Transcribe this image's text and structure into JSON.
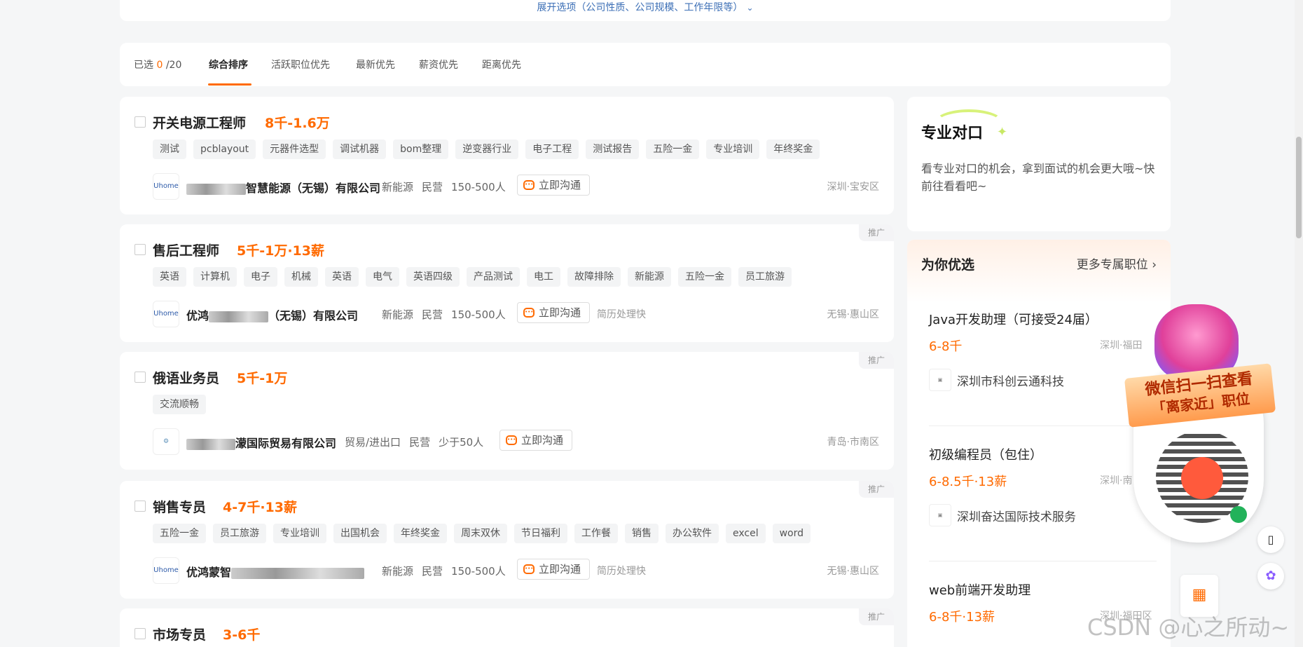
{
  "expand_link": "展开选项（公司性质、公司规模、工作年限等）",
  "sort_bar": {
    "selected_label": "已选",
    "selected_count": "0",
    "selected_total": "/20",
    "tabs": [
      "综合排序",
      "活跃职位优先",
      "最新优先",
      "薪资优先",
      "距离优先"
    ],
    "active_tab": "综合排序"
  },
  "jobs": [
    {
      "title": "开关电源工程师",
      "salary": "8千-1.6万",
      "tags": [
        "测试",
        "pcblayout",
        "元器件选型",
        "调试机器",
        "bom整理",
        "逆变器行业",
        "电子工程",
        "测试报告",
        "五险一金",
        "专业培训",
        "年终奖金"
      ],
      "company_visible": "智慧能源（无锡）有限公司",
      "logo_text": "Uhome",
      "industry": "新能源",
      "ownership": "民营",
      "size": "150-500人",
      "chat": "立即沟通",
      "location": "深圳·宝安区",
      "promoted": ""
    },
    {
      "title": "售后工程师",
      "salary": "5千-1万·13薪",
      "tags": [
        "英语",
        "计算机",
        "电子",
        "机械",
        "英语",
        "电气",
        "英语四级",
        "产品测试",
        "电工",
        "故障排除",
        "新能源",
        "五险一金",
        "员工旅游"
      ],
      "company_visible_a": "优鸿",
      "company_visible_b": "（无锡）有限公司",
      "logo_text": "Uhome",
      "industry": "新能源",
      "ownership": "民营",
      "size": "150-500人",
      "chat": "立即沟通",
      "fast": "简历处理快",
      "location": "无锡·惠山区",
      "promoted": "推广"
    },
    {
      "title": "俄语业务员",
      "salary": "5千-1万",
      "tags": [
        "交流顺畅"
      ],
      "company_visible": "濛国际贸易有限公司",
      "logo_text": "",
      "industry": "贸易/进出口",
      "ownership": "民营",
      "size": "少于50人",
      "chat": "立即沟通",
      "location": "青岛·市南区",
      "promoted": "推广"
    },
    {
      "title": "销售专员",
      "salary": "4-7千·13薪",
      "tags": [
        "五险一金",
        "员工旅游",
        "专业培训",
        "出国机会",
        "年终奖金",
        "周末双休",
        "节日福利",
        "工作餐",
        "销售",
        "办公软件",
        "excel",
        "word"
      ],
      "company_visible": "优鸿蒙智",
      "logo_text": "Uhome",
      "industry": "新能源",
      "ownership": "民营",
      "size": "150-500人",
      "chat": "立即沟通",
      "fast": "简历处理快",
      "location": "无锡·惠山区",
      "promoted": "推广"
    },
    {
      "title": "市场专员",
      "salary": "3-6千",
      "promoted": "推广"
    }
  ],
  "side_match": {
    "title": "专业对口",
    "desc": "看专业对口的机会，拿到面试的机会更大哦~快前往看看吧~"
  },
  "side_recommend": {
    "title": "为你优选",
    "more": "更多专属职位",
    "items": [
      {
        "title": "Java开发助理（可接受24届）",
        "salary": "6-8千",
        "location": "深圳·福田",
        "company": "深圳市科创云通科技"
      },
      {
        "title": "初级编程员（包住）",
        "salary": "6-8.5千·13薪",
        "location": "深圳·南",
        "company": "深圳奋达国际技术服务"
      },
      {
        "title": "web前端开发助理",
        "salary": "6-8千·13薪",
        "location": "深圳·福田区",
        "company": ""
      }
    ]
  },
  "promo_popup": {
    "line1": "微信扫一扫查看",
    "line2": "「离家近」职位"
  },
  "watermark": "CSDN @心之所动~"
}
